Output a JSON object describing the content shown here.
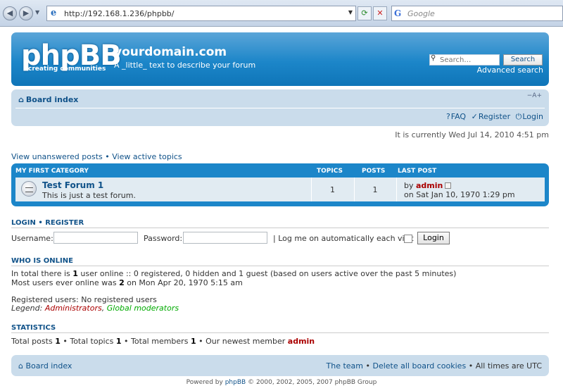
{
  "browser": {
    "url": "http://192.168.1.236/phpbb/",
    "google_placeholder": "Google"
  },
  "header": {
    "logo_text": "phpBB",
    "logo_tagline": "creating communities",
    "site_name": "yourdomain.com",
    "site_description": "A _little_ text to describe your forum",
    "search_placeholder": "Search…",
    "search_button": "Search",
    "advanced_search": "Advanced search"
  },
  "navbar": {
    "breadcrumb": "Board index",
    "font_size_toggle": "−A+",
    "faq": "FAQ",
    "register": "Register",
    "login": "Login"
  },
  "current_time": "It is currently Wed Jul 14, 2010 4:51 pm",
  "quicklinks": {
    "unanswered": "View unanswered posts",
    "sep": "•",
    "active": "View active topics"
  },
  "forum_table": {
    "category": "MY FIRST CATEGORY",
    "col_topics": "TOPICS",
    "col_posts": "POSTS",
    "col_last_post": "LAST POST",
    "forums": [
      {
        "title": "Test Forum 1",
        "description": "This is just a test forum.",
        "topics": "1",
        "posts": "1",
        "last_post_by": "by",
        "last_post_user": "admin",
        "last_post_date": "on Sat Jan 10, 1970 1:29 pm"
      }
    ]
  },
  "login": {
    "heading_login": "LOGIN",
    "heading_sep": "•",
    "heading_register": "REGISTER",
    "username_label": "Username:",
    "password_label": "Password:",
    "remember_label": "| Log me on automatically each visit",
    "login_button": "Login"
  },
  "online": {
    "heading": "WHO IS ONLINE",
    "line1_pre": "In total there is",
    "line1_count": "1",
    "line1_post": "user online :: 0 registered, 0 hidden and 1 guest (based on users active over the past 5 minutes)",
    "line2_pre": "Most users ever online was",
    "line2_count": "2",
    "line2_post": "on Mon Apr 20, 1970 5:15 am",
    "registered_users": "Registered users: No registered users",
    "legend_label": "Legend:",
    "legend_admins": "Administrators",
    "legend_sep": ",",
    "legend_mods": "Global moderators"
  },
  "statistics": {
    "heading": "STATISTICS",
    "posts_label": "Total posts",
    "posts": "1",
    "topics_label": "Total topics",
    "topics": "1",
    "members_label": "Total members",
    "members": "1",
    "newest_label": "Our newest member",
    "newest": "admin",
    "sep": "•"
  },
  "footer": {
    "board_index": "Board index",
    "team": "The team",
    "sep": "•",
    "delete_cookies": "Delete all board cookies",
    "timezone": "All times are UTC",
    "powered_pre": "Powered by",
    "powered_link": "phpBB",
    "powered_post": "© 2000, 2002, 2005, 2007 phpBB Group"
  },
  "colors": {
    "header_blue": "#1c86c9",
    "nav_bg": "#cadceb",
    "link": "#105289",
    "admin": "#aa0000",
    "moderator": "#00aa00"
  }
}
